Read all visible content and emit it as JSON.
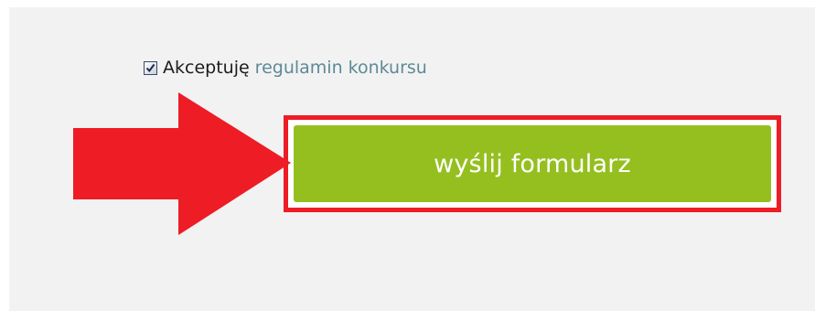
{
  "consent": {
    "checked": true,
    "text": "Akceptuję",
    "link_text": "regulamin konkursu"
  },
  "form": {
    "submit_label": "wyślij formularz"
  },
  "annotation": {
    "arrow_color": "#ee1c25",
    "frame_color": "#ee1c25"
  },
  "colors": {
    "panel_background": "#f2f2f2",
    "button_background": "#95bf1f",
    "button_text": "#ffffff",
    "link": "#5d8a96"
  },
  "icons": {
    "checkbox": "checked-checkbox-icon",
    "annotation": "red-arrow-icon"
  }
}
